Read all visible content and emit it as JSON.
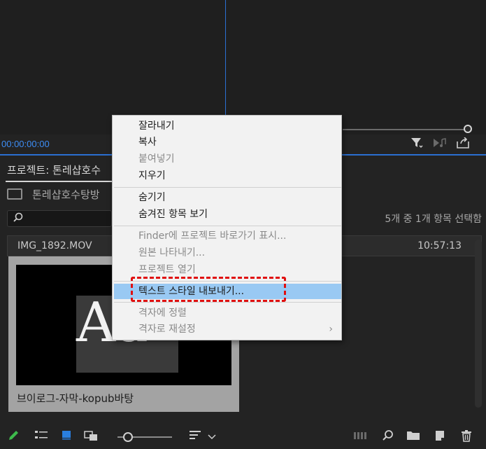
{
  "monitor": {
    "timecode": "00:00:00:00",
    "icons": [
      "filter-icon",
      "audio-icon",
      "export-icon"
    ]
  },
  "project": {
    "tab_label": "프로젝트: 톤레샵호수",
    "bin_label": "톤레샵호수탕방",
    "search_placeholder": "",
    "item_count": "5개 중 1개 항목 선택함",
    "clip": {
      "name": "IMG_1892.MOV",
      "time": "10:57:13",
      "thumb_text": "Aa",
      "caption": "브이로그-자막-kopub바탕"
    }
  },
  "context_menu": {
    "items": [
      {
        "label": "잘라내기",
        "disabled": false
      },
      {
        "label": "복사",
        "disabled": false
      },
      {
        "label": "붙여넣기",
        "disabled": true
      },
      {
        "label": "지우기",
        "disabled": false
      },
      {
        "label": "숨기기",
        "disabled": false
      },
      {
        "label": "숨겨진 항목 보기",
        "disabled": false
      },
      {
        "label": "Finder에 프로젝트 바로가기 표시...",
        "disabled": true
      },
      {
        "label": "원본 나타내기...",
        "disabled": true
      },
      {
        "label": "프로젝트 열기",
        "disabled": true
      },
      {
        "label": "텍스트 스타일 내보내기...",
        "disabled": false,
        "highlighted": true
      },
      {
        "label": "격자에 정렬",
        "disabled": true
      },
      {
        "label": "격자로 재설정",
        "disabled": true,
        "submenu_arrow": "›"
      }
    ]
  },
  "bottom_bar": {
    "icons": [
      "pencil-icon",
      "list-view-icon",
      "icon-view-icon",
      "freeform-view-icon",
      "zoom-slider",
      "sort-icon",
      "chevron-down-icon",
      "automate-icon",
      "search-icon",
      "new-bin-icon",
      "new-item-icon",
      "trash-icon"
    ]
  },
  "colors": {
    "accent": "#2a6fd1",
    "timecode": "#3d8df5",
    "highlight": "#99c9f3",
    "annotation": "#e01010"
  }
}
